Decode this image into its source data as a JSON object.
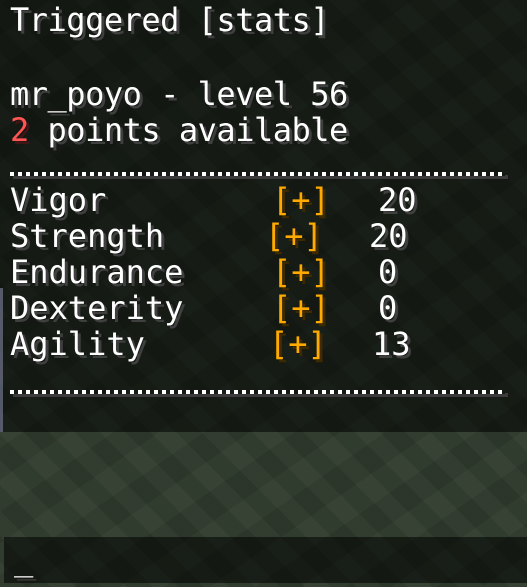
{
  "chat": {
    "title": "Triggered [stats]",
    "player_line": "mr_poyo - level 56",
    "points_value": "2",
    "points_text": " points available",
    "stats": [
      {
        "name": "Vigor",
        "button": "[+]",
        "value": "20"
      },
      {
        "name": "Strength",
        "button": "[+]",
        "value": "20"
      },
      {
        "name": "Endurance",
        "button": "[+]",
        "value": "0"
      },
      {
        "name": "Dexterity",
        "button": "[+]",
        "value": "0"
      },
      {
        "name": "Agility",
        "button": "[+]",
        "value": "13"
      }
    ]
  },
  "input": {
    "cursor": "_"
  },
  "colors": {
    "text": "#ffffff",
    "points_highlight": "#ff5555",
    "button": "#ffaa00",
    "panel_bg": "rgba(0,0,0,0.55)"
  }
}
